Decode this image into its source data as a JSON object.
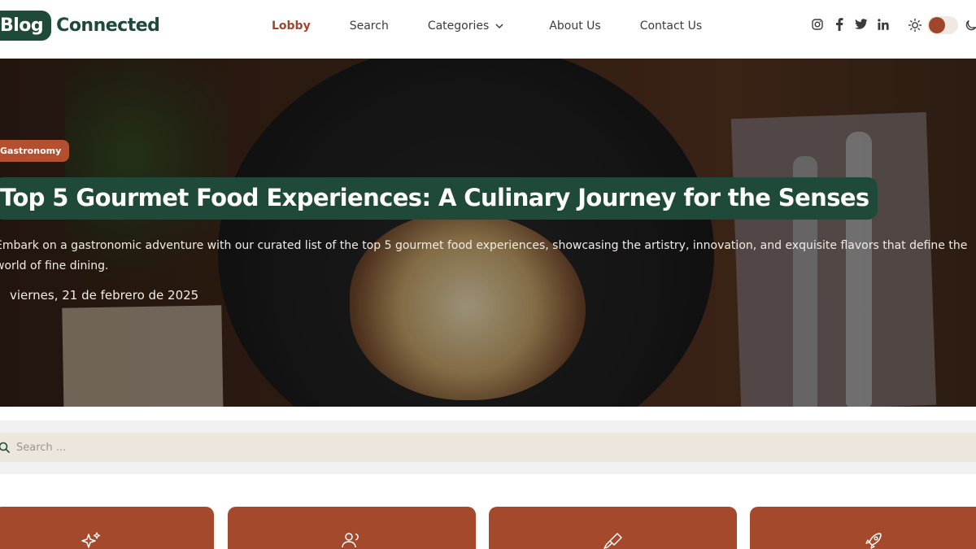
{
  "header": {
    "logo_badge": "Blog",
    "logo_text": "Connected",
    "nav": {
      "lobby": "Lobby",
      "search": "Search",
      "categories": "Categories",
      "about": "About Us",
      "contact": "Contact Us"
    },
    "social_icons": [
      "instagram-icon",
      "facebook-icon",
      "twitter-icon",
      "linkedin-icon"
    ],
    "theme": {
      "light_icon": "sun-icon",
      "dark_icon": "moon-icon",
      "mode": "light"
    }
  },
  "hero": {
    "category_tag": "Gastronomy",
    "title": "Top 5 Gourmet Food Experiences: A Culinary Journey for the Senses",
    "description": "Embark on a gastronomic adventure with our curated list of the top 5 gourmet food experiences, showcasing the artistry, innovation, and exquisite flavors that define the world of fine dining.",
    "date": "viernes, 21 de febrero de 2025"
  },
  "search": {
    "placeholder": "Search ..."
  },
  "category_cards": [
    {
      "icon": "sparkles-icon"
    },
    {
      "icon": "users-icon"
    },
    {
      "icon": "brush-icon"
    },
    {
      "icon": "rocket-icon"
    }
  ],
  "colors": {
    "brand_green": "#1f4a3a",
    "accent_rust": "#a4492b",
    "search_bg": "#ece6dc"
  }
}
